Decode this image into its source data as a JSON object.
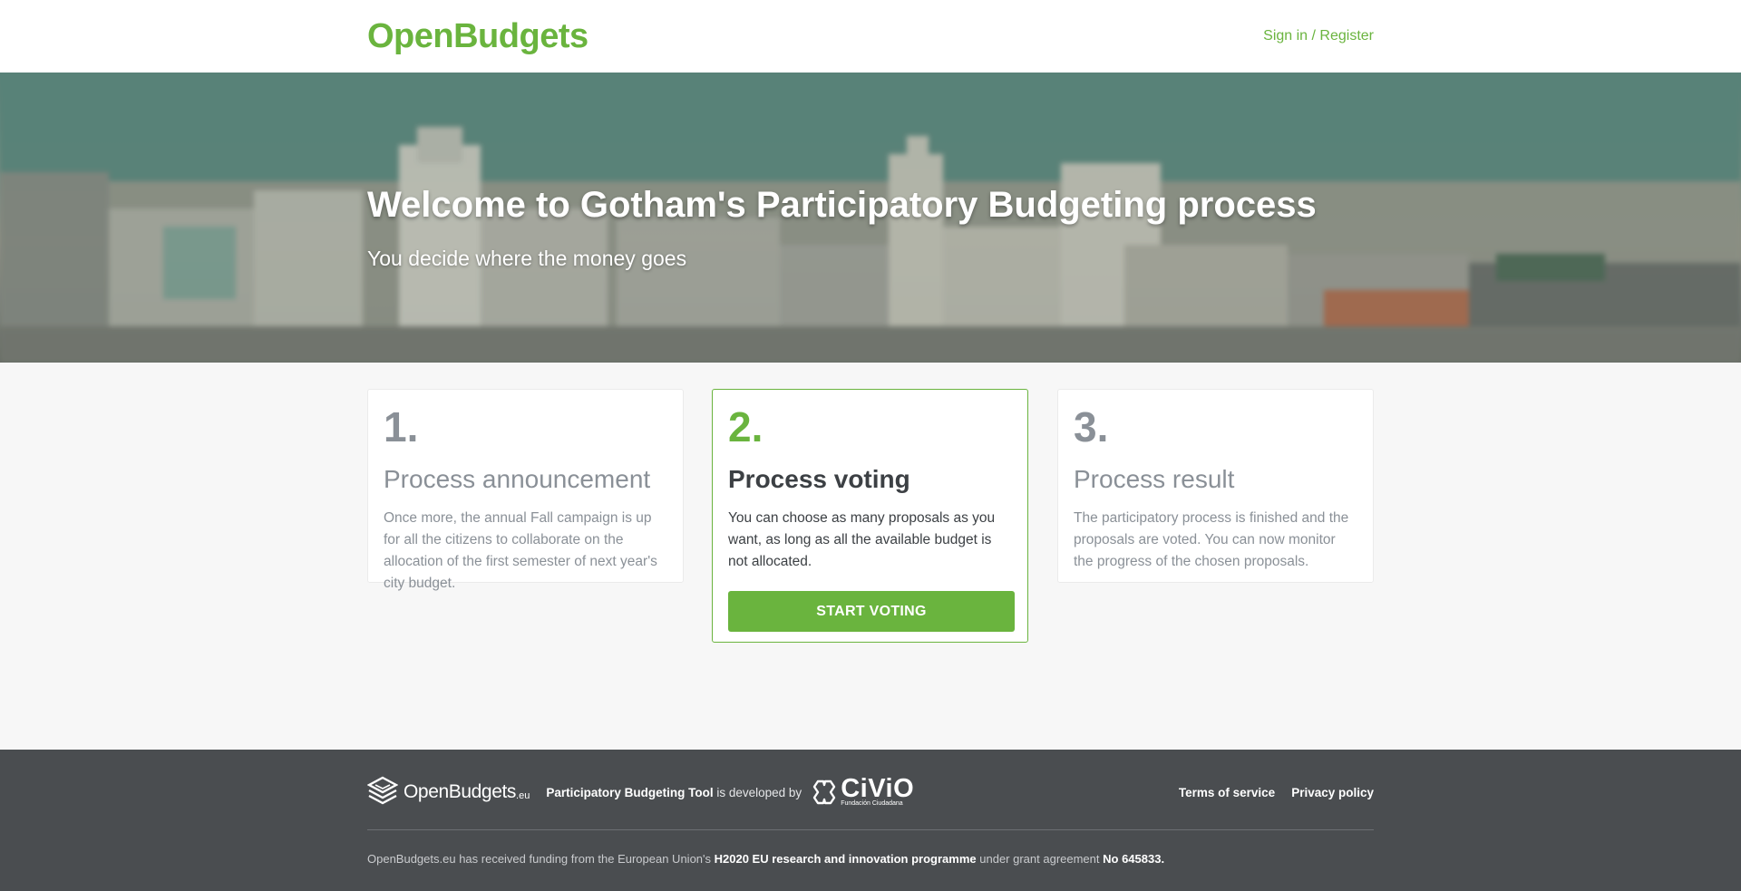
{
  "header": {
    "brand": "OpenBudgets",
    "signin_label": "Sign in / Register"
  },
  "hero": {
    "title": "Welcome to Gotham's Participatory Budgeting process",
    "subtitle": "You decide where the money goes"
  },
  "steps": [
    {
      "number": "1.",
      "title": "Process announcement",
      "text": "Once more, the annual Fall campaign is up for all the citizens to collaborate on the allocation of the first semester of next year's city budget."
    },
    {
      "number": "2.",
      "title": "Process voting",
      "text": "You can choose as many proposals as you want, as long as all the available budget is not allocated.",
      "button_label": "START VOTING"
    },
    {
      "number": "3.",
      "title": "Process result",
      "text": "The participatory process is finished and the proposals are voted. You can now monitor the progress of the chosen proposals."
    }
  ],
  "footer": {
    "logo_name": "OpenBudgets",
    "logo_suffix": ".eu",
    "dev_tool": "Participatory Budgeting Tool",
    "dev_text": "is developed by",
    "civio_name": "CiViO",
    "civio_sub": "Fundación Ciudadana",
    "links": [
      "Terms of service",
      "Privacy policy"
    ],
    "funding_prefix": "OpenBudgets.eu has received funding from the European Union's",
    "funding_programme": "H2020 EU research and innovation programme",
    "funding_middle": "under grant agreement",
    "funding_grant": "No 645833."
  },
  "colors": {
    "accent": "#6ab43e",
    "footer_bg": "#4a4d50",
    "page_bg": "#f7f7f7"
  }
}
